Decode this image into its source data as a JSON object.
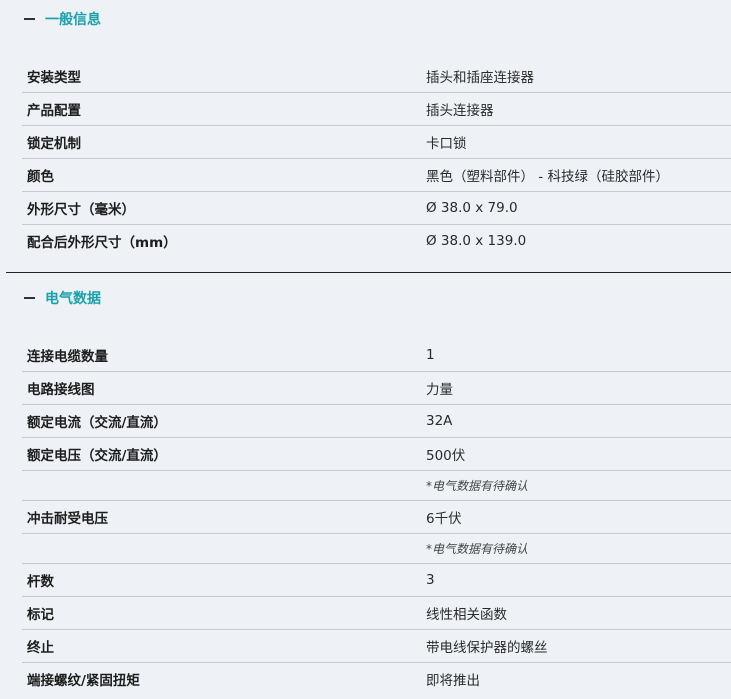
{
  "general": {
    "title": "一般信息",
    "rows": [
      {
        "key": "安装类型",
        "value": "插头和插座连接器"
      },
      {
        "key": "产品配置",
        "value": "插头连接器"
      },
      {
        "key": "锁定机制",
        "value": "卡口锁"
      },
      {
        "key": "颜色",
        "value": "黑色（塑料部件） - 科技绿（硅胶部件）"
      },
      {
        "key": "外形尺寸（毫米）",
        "value": "Ø 38.0 x 79.0"
      },
      {
        "key": "配合后外形尺寸（mm）",
        "value": "Ø 38.0 x 139.0"
      }
    ]
  },
  "electrical": {
    "title": "电气数据",
    "rows": [
      {
        "key": "连接电缆数量",
        "value": "1"
      },
      {
        "key": "电路接线图",
        "value": "力量"
      },
      {
        "key": "额定电流（交流/直流）",
        "value": "32A"
      },
      {
        "key": "额定电压（交流/直流）",
        "value": "500伏"
      },
      {
        "key": "",
        "value": "*电气数据有待确认"
      },
      {
        "key": "冲击耐受电压",
        "value": "6千伏"
      },
      {
        "key": "",
        "value": "*电气数据有待确认"
      },
      {
        "key": "杆数",
        "value": "3"
      },
      {
        "key": "标记",
        "value": "线性相关函数"
      },
      {
        "key": "终止",
        "value": "带电线保护器的螺丝"
      },
      {
        "key": "端接螺纹/紧固扭矩",
        "value": "即将推出"
      }
    ]
  }
}
